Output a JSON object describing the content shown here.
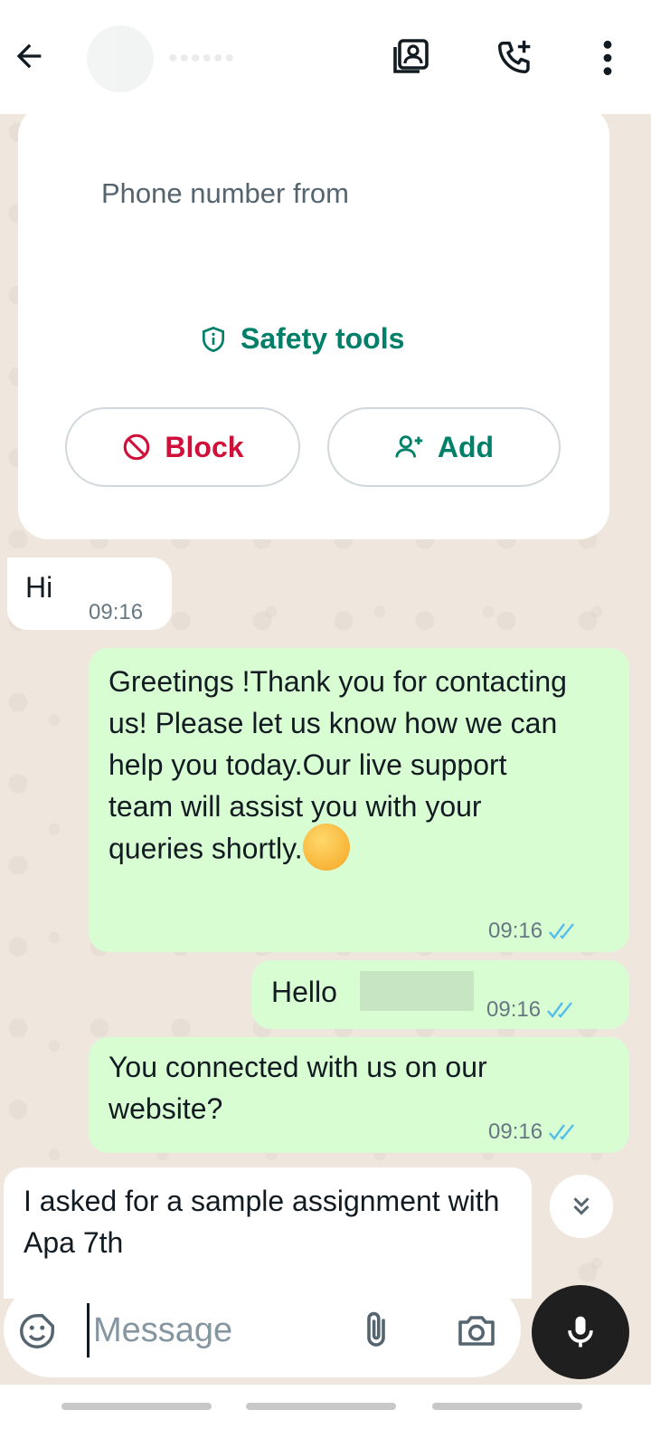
{
  "header": {
    "contact_name": "••••••",
    "icons": [
      "arrow-left-icon",
      "video-call-icon",
      "phone-add-icon",
      "more-vertical-icon"
    ]
  },
  "info_card": {
    "text": "Phone number from",
    "safety_tools": "Safety tools",
    "block_label": "Block",
    "add_label": "Add",
    "colors": {
      "safety": "#008069",
      "block": "#d0103a"
    }
  },
  "messages": [
    {
      "direction": "in",
      "text": "Hi",
      "time": "09:16"
    },
    {
      "direction": "out",
      "text": "Greetings !Thank you for contacting us! Please let us know how we can help you today.Our live support team will assist you with your queries shortly.",
      "emoji": "smiling-face-icon",
      "time": "09:16",
      "status": "read"
    },
    {
      "direction": "out",
      "text": "Hello",
      "time": "09:16",
      "status": "read"
    },
    {
      "direction": "out",
      "text": "You connected with us on our website?",
      "time": "09:16",
      "status": "read"
    },
    {
      "direction": "in",
      "text": "I asked for a sample assignment with Apa 7th"
    }
  ],
  "composer": {
    "placeholder": "Message"
  },
  "colors": {
    "outgoing_bubble": "#d9fdd3",
    "incoming_bubble": "#ffffff",
    "chat_bg": "#efe7dd",
    "read_tick": "#53bdeb"
  }
}
